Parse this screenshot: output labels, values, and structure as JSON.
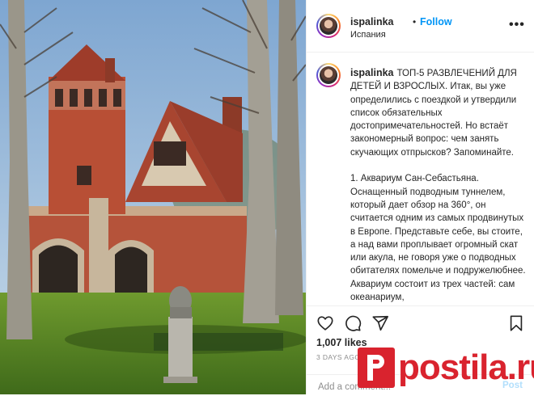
{
  "header": {
    "username": "ispalinka",
    "dot": "•",
    "follow_label": "Follow",
    "location": "Испания",
    "more_icon": "more-dots-icon"
  },
  "caption": {
    "username": "ispalinka",
    "text": "ТОП-5 РАЗВЛЕЧЕНИЙ ДЛЯ ДЕТЕЙ И ВЗРОСЛЫХ. Итак, вы уже определились с поездкой и утвердили список обязательных достопримечательностей. Но встаёт закономерный вопрос: чем занять скучающих отпрысков? Запоминайте.\n\n1. Аквариум Сан-Себастьяна. Оснащенный подводным туннелем, который дает обзор на 360°, он считается одним из самых продвинутых в Европе. Представьте себе, вы стоите, а над вами проплывает огромный скат или акула, не говоря уже о подводных обитателях помельче и подружелюбнее. Аквариум состоит из трех частей: сам океанариум,"
  },
  "actions": {
    "icons": [
      "heart-icon",
      "comment-icon",
      "share-icon",
      "bookmark-icon"
    ],
    "likes": "1,007 likes",
    "time_ago": "3 DAYS AGO"
  },
  "comment": {
    "placeholder": "Add a comment...",
    "post_label": "Post"
  },
  "watermark": {
    "text": "postila.ru",
    "color": "#d9232e"
  },
  "colors": {
    "accent": "#0095f6",
    "post_disabled": "#b2dffc",
    "text": "#262626",
    "muted": "#8e8e8e"
  }
}
